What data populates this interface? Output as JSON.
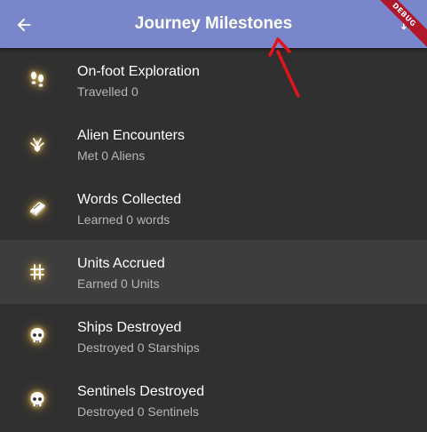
{
  "appbar": {
    "title": "Journey Milestones",
    "back_icon": "arrow-back-icon",
    "action_icon": "sort-icon",
    "background": "#7986cb"
  },
  "debug_banner": "DEBUG",
  "icon_glow_color": "#ffd25a",
  "milestones": [
    {
      "label": "On-foot Exploration",
      "subtitle": "Travelled 0",
      "icon": "footprints-icon"
    },
    {
      "label": "Alien Encounters",
      "subtitle": "Met 0 Aliens",
      "icon": "alien-hand-icon"
    },
    {
      "label": "Words Collected",
      "subtitle": "Learned 0 words",
      "icon": "book-icon"
    },
    {
      "label": "Units Accrued",
      "subtitle": "Earned 0 Units",
      "icon": "units-icon"
    },
    {
      "label": "Ships Destroyed",
      "subtitle": "Destroyed 0 Starships",
      "icon": "skull-icon"
    },
    {
      "label": "Sentinels Destroyed",
      "subtitle": "Destroyed 0 Sentinels",
      "icon": "skull-icon"
    }
  ]
}
